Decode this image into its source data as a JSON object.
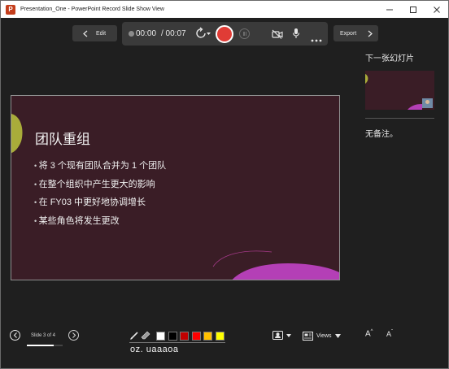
{
  "window": {
    "title": "Presentation_One - PowerPoint Record Slide Show View",
    "app_icon": "powerpoint-icon"
  },
  "toolbar": {
    "edit_label": "Edit",
    "export_label": "Export",
    "elapsed_time": "00:00",
    "total_time": "/ 00:07"
  },
  "slide": {
    "title": "团队重组",
    "bullets": [
      "将 3 个现有团队合并为 1 个团队",
      "在整个组织中产生更大的影响",
      "在 FY03 中更好地协调增长",
      "某些角色将发生更改"
    ]
  },
  "side_panel": {
    "next_slide_label": "下一张幻灯片",
    "notes_text": "无备注。"
  },
  "footer": {
    "slide_counter": "Slide 3 of 4",
    "progress": 0.75,
    "views_label": "Views",
    "font_increase": "A",
    "font_decrease": "A",
    "ink_caption": "oz. uaaaoa",
    "ink_colors": [
      "#ffffff",
      "#000000",
      "#c00000",
      "#ff0000",
      "#ffc000",
      "#ffff00"
    ]
  },
  "colors": {
    "background": "#1f1f1f",
    "record": "#e03c36",
    "slide_background": "#3a1d26",
    "accent_olive": "#a9ac3a",
    "accent_magenta": "#b43fb6"
  }
}
